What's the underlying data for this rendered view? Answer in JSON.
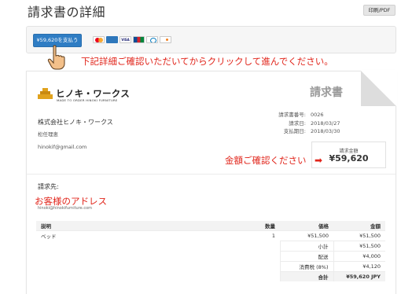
{
  "page": {
    "title": "請求書の詳細",
    "print_button": "印刷/PDF"
  },
  "payment": {
    "pay_button": "¥59,620を支払う",
    "cards": [
      "mastercard-icon",
      "amex-icon",
      "visa-icon",
      "jcb-icon",
      "diners-icon",
      "discover-icon"
    ],
    "visa_text": "VISA"
  },
  "annotations": {
    "note_click": "下記詳細ご確認いただいてからクリックして進んでください。",
    "note_amount": "金額ご確認ください",
    "note_address": "お客様のアドレス",
    "accent_color": "#e1251b"
  },
  "invoice": {
    "doc_title": "請求書",
    "logo_text": "ヒノキ・ワークス",
    "logo_sub": "MADE TO ORDER HINOKI FURNITURE",
    "company": "株式会社ヒノキ・ワークス",
    "person": "松任理恵",
    "email": "hinokif@gmail.com",
    "meta": {
      "number_label": "請求書番号:",
      "number_value": "0026",
      "date_label": "請求日:",
      "date_value": "2018/03/27",
      "due_label": "支払期日:",
      "due_value": "2018/03/30"
    },
    "total_label": "請求金額",
    "total_amount": "¥59,620",
    "bill_to_label": "請求先:",
    "bill_to_email": "hinoki@hinokifurniture.com"
  },
  "table": {
    "headers": {
      "desc": "説明",
      "qty": "数量",
      "price": "価格",
      "amount": "金額"
    },
    "rows": [
      {
        "desc": "ベッド",
        "qty": "1",
        "price": "¥51,500",
        "amount": "¥51,500"
      }
    ],
    "summary": {
      "subtotal_label": "小計",
      "subtotal_value": "¥51,500",
      "shipping_label": "配送",
      "shipping_value": "¥4,000",
      "tax_label": "消費税 (8%)",
      "tax_value": "¥4,120",
      "total_label": "合計",
      "total_value": "¥59,620 JPY"
    }
  },
  "colors": {
    "pay_button": "#2f7dc4",
    "logo_gold": "#e0a21d"
  }
}
